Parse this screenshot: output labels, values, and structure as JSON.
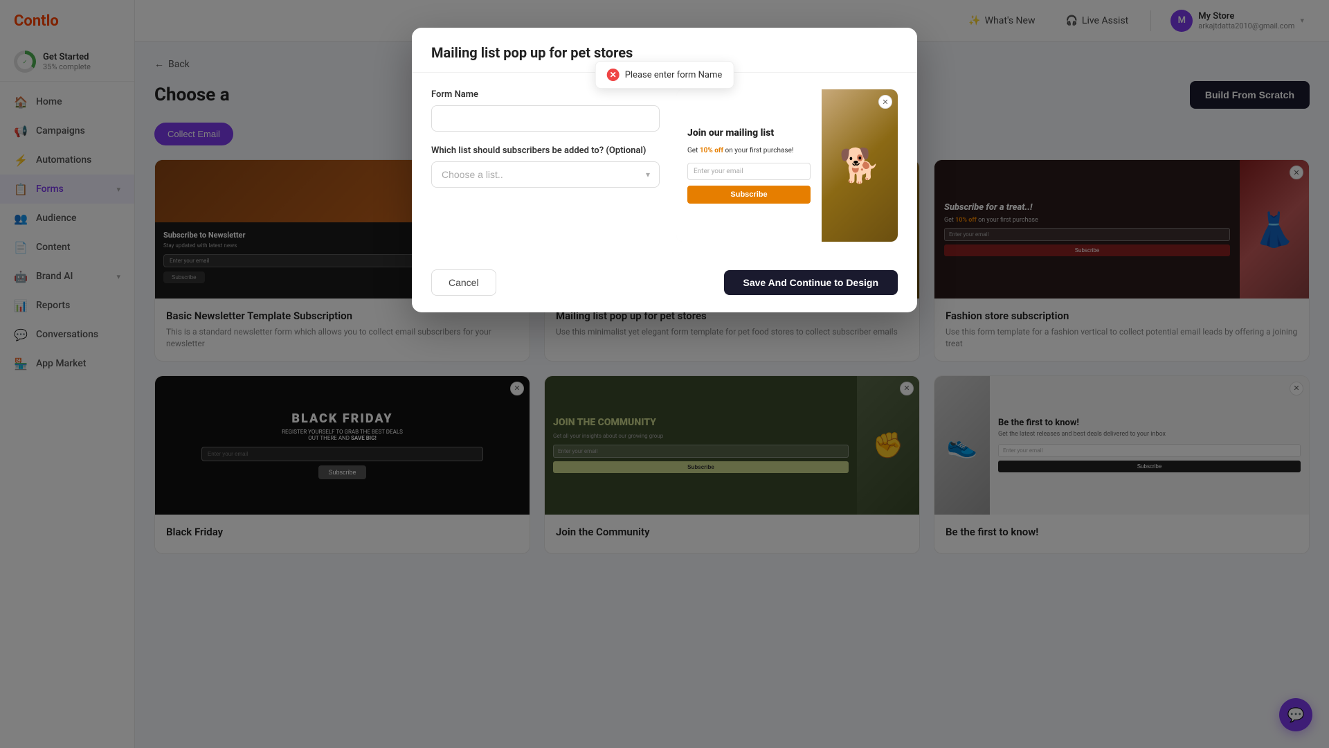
{
  "app": {
    "logo": "Contlo"
  },
  "sidebar": {
    "get_started": {
      "title": "Get Started",
      "progress": "35% complete",
      "percent": 35
    },
    "items": [
      {
        "id": "home",
        "label": "Home",
        "icon": "🏠",
        "active": false
      },
      {
        "id": "campaigns",
        "label": "Campaigns",
        "icon": "📢",
        "active": false
      },
      {
        "id": "automations",
        "label": "Automations",
        "icon": "⚡",
        "active": false
      },
      {
        "id": "forms",
        "label": "Forms",
        "icon": "📋",
        "active": true,
        "arrow": true
      },
      {
        "id": "audience",
        "label": "Audience",
        "icon": "👥",
        "active": false
      },
      {
        "id": "content",
        "label": "Content",
        "icon": "📄",
        "active": false
      },
      {
        "id": "brand-ai",
        "label": "Brand AI",
        "icon": "🤖",
        "active": false,
        "arrow": true
      },
      {
        "id": "reports",
        "label": "Reports",
        "icon": "📊",
        "active": false
      },
      {
        "id": "conversations",
        "label": "Conversations",
        "icon": "💬",
        "active": false
      },
      {
        "id": "app-market",
        "label": "App Market",
        "icon": "🏪",
        "active": false
      }
    ]
  },
  "header": {
    "whats_new_label": "What's New",
    "live_assist_label": "Live Assist",
    "user": {
      "avatar_initial": "M",
      "store_name": "My Store",
      "email": "arkajtdatta2010@gmail.com"
    }
  },
  "content": {
    "back_label": "Back",
    "title": "Choose a",
    "build_from_scratch_label": "Build From Scratch",
    "filter_tabs": [
      {
        "id": "collect-email",
        "label": "Collect Email",
        "active": true
      }
    ],
    "templates": [
      {
        "id": "basic-newsletter",
        "name": "Basic Newsletter Template Subscription",
        "description": "This is a standard newsletter form which allows you to collect email subscribers for your newsletter",
        "type": "dark"
      },
      {
        "id": "mailing-pet",
        "name": "Mailing list pop up for pet stores",
        "description": "Use this minimalist yet elegant form template for pet food stores to collect subscriber emails",
        "type": "mailing-pet"
      },
      {
        "id": "fashion-store",
        "name": "Fashion store subscription",
        "description": "Use this form template for a fashion vertical to collect potential email leads by offering a joining treat",
        "type": "fashion"
      },
      {
        "id": "black-friday",
        "name": "Black Friday",
        "description": "",
        "type": "black-friday"
      },
      {
        "id": "join-community",
        "name": "Join the Community",
        "description": "",
        "type": "community"
      },
      {
        "id": "first-to-know",
        "name": "Be the first to know!",
        "description": "",
        "type": "shoes"
      }
    ]
  },
  "modal": {
    "title": "Mailing list pop up for pet stores",
    "form_name_label": "Form Name",
    "form_name_placeholder": "",
    "form_name_value": "",
    "list_label": "Which list should subscribers be added to? (Optional)",
    "list_placeholder": "Choose a list..",
    "list_options": [
      "Choose a list.."
    ],
    "cancel_label": "Cancel",
    "save_label": "Save And Continue to Design",
    "preview": {
      "title": "Join our mailing list",
      "discount_text": "Get ",
      "discount_value": "10% off",
      "discount_suffix": " on your first purchase!",
      "email_placeholder": "Enter your email",
      "subscribe_label": "Subscribe"
    }
  },
  "error": {
    "message": "Please enter form Name"
  }
}
